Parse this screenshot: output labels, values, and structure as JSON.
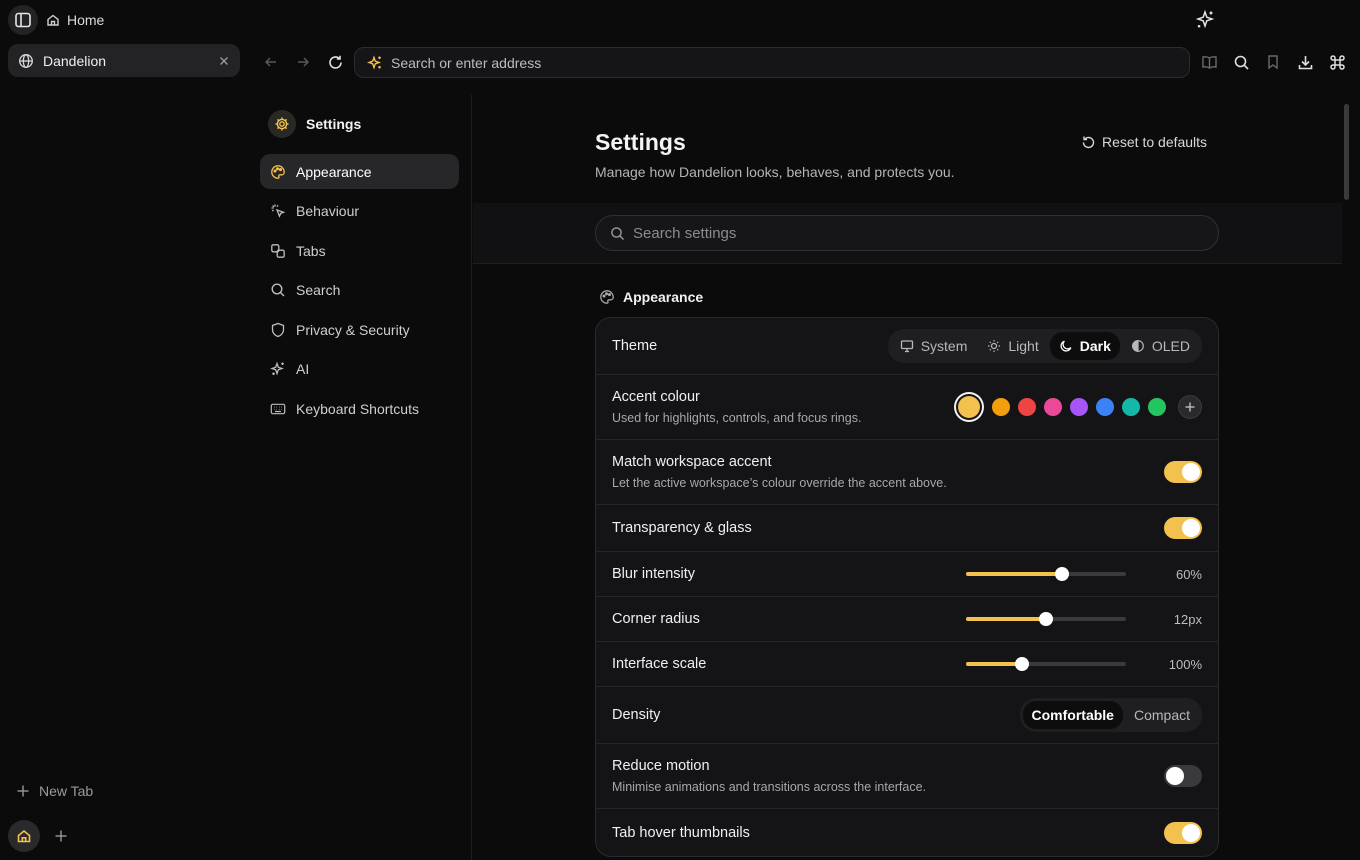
{
  "window": {
    "home_label": "Home"
  },
  "sidebar": {
    "tab_title": "Dandelion",
    "new_tab_label": "New Tab"
  },
  "toolbar": {
    "address_placeholder": "Search or enter address"
  },
  "settings_nav": {
    "title": "Settings",
    "items": [
      {
        "label": "Appearance",
        "icon": "palette-icon",
        "active": true
      },
      {
        "label": "Behaviour",
        "icon": "pointer-click-icon",
        "active": false
      },
      {
        "label": "Tabs",
        "icon": "tabs-icon",
        "active": false
      },
      {
        "label": "Search",
        "icon": "search-icon",
        "active": false
      },
      {
        "label": "Privacy & Security",
        "icon": "shield-icon",
        "active": false
      },
      {
        "label": "AI",
        "icon": "sparkle-icon",
        "active": false
      },
      {
        "label": "Keyboard Shortcuts",
        "icon": "keyboard-icon",
        "active": false
      }
    ]
  },
  "page": {
    "title": "Settings",
    "subtitle": "Manage how Dandelion looks, behaves, and protects you.",
    "reset_label": "Reset to defaults",
    "search_placeholder": "Search settings",
    "section_title": "Appearance"
  },
  "appearance": {
    "theme": {
      "label": "Theme",
      "options": [
        "System",
        "Light",
        "Dark",
        "OLED"
      ],
      "selected": "Dark"
    },
    "accent": {
      "label": "Accent colour",
      "description": "Used for highlights, controls, and focus rings.",
      "colors": [
        "#f2c14e",
        "#f59e0b",
        "#ef4444",
        "#ec4899",
        "#a855f7",
        "#3b82f6",
        "#14b8a6",
        "#22c55e"
      ],
      "selected": "#f2c14e"
    },
    "match_workspace": {
      "label": "Match workspace accent",
      "description": "Let the active workspace’s colour override the accent above.",
      "on": true
    },
    "transparency": {
      "label": "Transparency & glass",
      "on": true
    },
    "blur": {
      "label": "Blur intensity",
      "value_text": "60%",
      "fraction": 0.6
    },
    "corner": {
      "label": "Corner radius",
      "value_text": "12px",
      "fraction": 0.5
    },
    "scale": {
      "label": "Interface scale",
      "value_text": "100%",
      "fraction": 0.35
    },
    "density": {
      "label": "Density",
      "options": [
        "Comfortable",
        "Compact"
      ],
      "selected": "Comfortable"
    },
    "reduce_motion": {
      "label": "Reduce motion",
      "description": "Minimise animations and transitions across the interface.",
      "on": false
    },
    "tab_thumbnails": {
      "label": "Tab hover thumbnails",
      "on": true
    }
  },
  "colors": {
    "accent": "#f2c14e",
    "background": "#0b0b0c",
    "card": "#141416"
  }
}
